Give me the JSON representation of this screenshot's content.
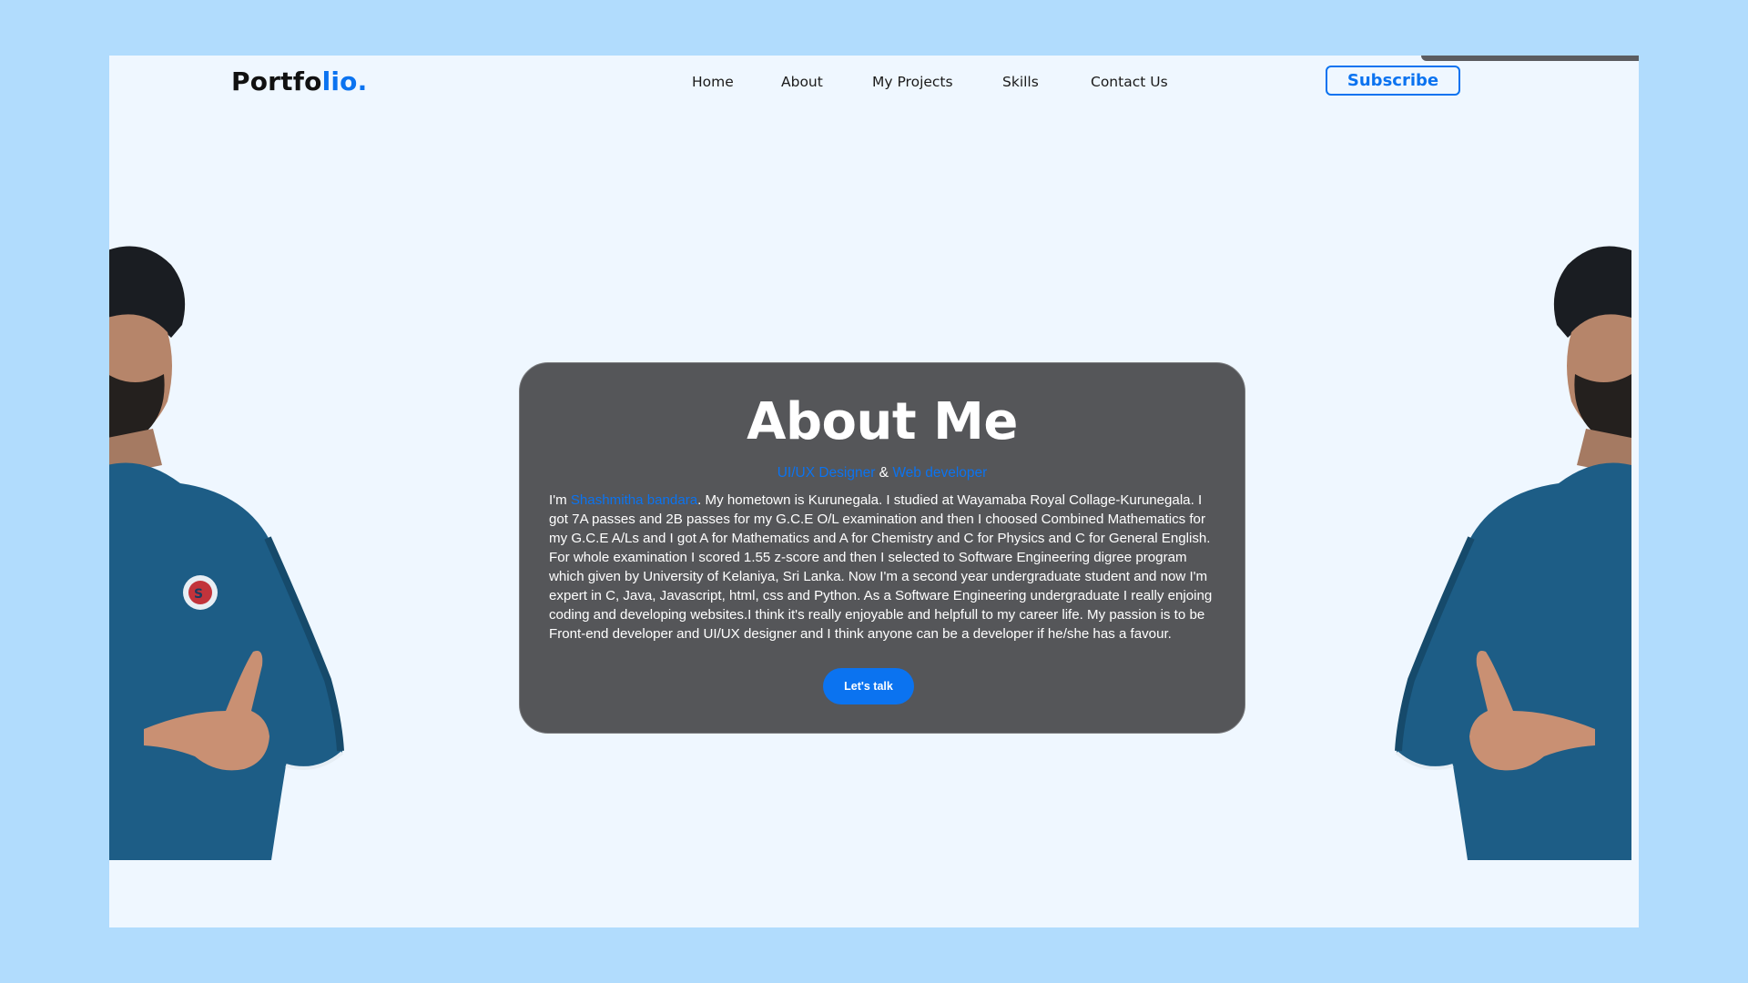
{
  "header": {
    "logo_main": "Portfo",
    "logo_accent": "lio.",
    "nav": [
      "Home",
      "About",
      "My Projects",
      "Skills",
      "Contact Us"
    ],
    "subscribe_label": "Subscribe"
  },
  "about": {
    "title": "About Me",
    "role_1": "UI/UX Designer",
    "role_sep": " & ",
    "role_2": "Web developer",
    "bio_prefix": "I'm ",
    "name": "Shashmitha bandara",
    "bio_text": ". My hometown is Kurunegala. I studied at Wayamaba Royal Collage-Kurunegala. I got 7A passes and 2B passes for my G.C.E O/L examination and then I choosed Combined Mathematics for my G.C.E A/Ls and I got A for Mathematics and A for Chemistry and C for Physics and C for General English. For whole examination I scored 1.55 z-score and then I selected to Software Engineering digree program which given by University of Kelaniya, Sri Lanka. Now I'm a second year undergraduate student and now I'm expert in C, Java, Javascript, html, css and Python. As a Software Engineering undergraduate I really enjoing coding and developing websites.I think it's really enjoyable and helpfull to my career life. My passion is to be Front-end developer and UI/UX designer and I think anyone can be a developer if he/she has a favour.",
    "cta_label": "Let's talk"
  },
  "colors": {
    "page_bg": "#b1dcfd",
    "frame_bg": "#eff7ff",
    "accent": "#0b73f0",
    "card_bg": "#555659"
  }
}
